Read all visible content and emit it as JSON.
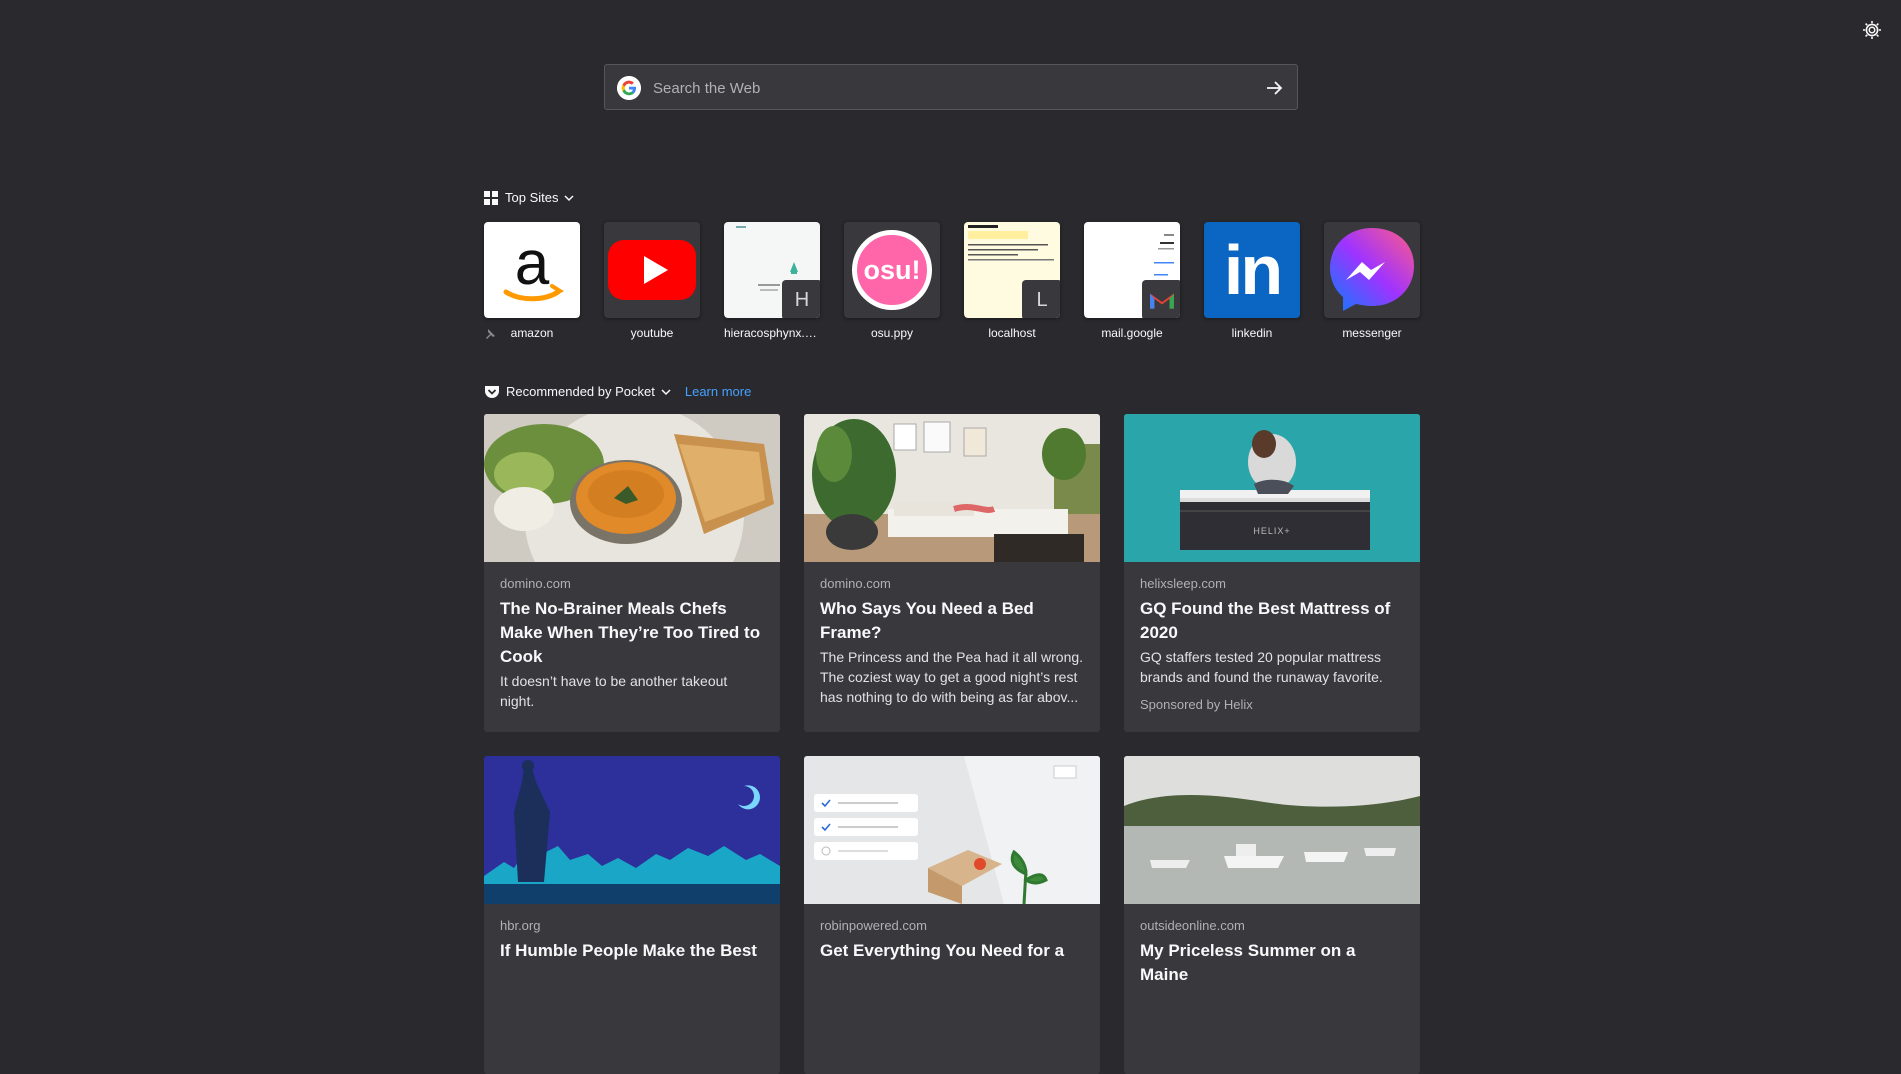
{
  "search": {
    "placeholder": "Search the Web"
  },
  "top_sites": {
    "title": "Top Sites",
    "tiles": [
      {
        "label": "amazon"
      },
      {
        "label": "youtube"
      },
      {
        "label": "hieracosphynx.p...",
        "badge": "H"
      },
      {
        "label": "osu.ppy",
        "logo_text": "osu!"
      },
      {
        "label": "localhost",
        "badge": "L"
      },
      {
        "label": "mail.google"
      },
      {
        "label": "linkedin",
        "logo_text": "in"
      },
      {
        "label": "messenger"
      }
    ]
  },
  "pocket": {
    "title": "Recommended by Pocket",
    "learn_more": "Learn more",
    "cards": [
      {
        "source": "domino.com",
        "title": "The No-Brainer Meals Chefs Make When They’re Too Tired to Cook",
        "description": "It doesn’t have to be another takeout night."
      },
      {
        "source": "domino.com",
        "title": "Who Says You Need a Bed Frame?",
        "description": "The Princess and the Pea had it all wrong. The coziest way to get a good night’s rest has nothing to do with being as far abov..."
      },
      {
        "source": "helixsleep.com",
        "title": "GQ Found the Best Mattress of 2020",
        "description": "GQ staffers tested 20 popular mattress brands and found the runaway favorite.",
        "sponsor": "Sponsored by Helix",
        "logo_text": "HELIX+"
      },
      {
        "source": "hbr.org",
        "title": "If Humble People Make the Best"
      },
      {
        "source": "robinpowered.com",
        "title": "Get Everything You Need for a"
      },
      {
        "source": "outsideonline.com",
        "title": "My Priceless Summer on a Maine"
      }
    ]
  }
}
